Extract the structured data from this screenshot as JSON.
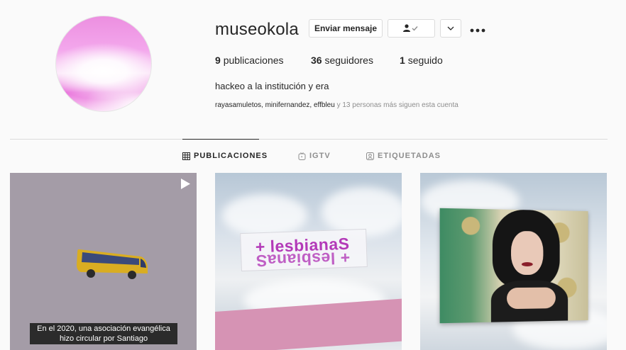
{
  "profile": {
    "username": "museokola",
    "buttons": {
      "message": "Enviar mensaje"
    },
    "stats": {
      "posts_count": "9",
      "posts_label": "publicaciones",
      "followers_count": "36",
      "followers_label": "seguidores",
      "following_count": "1",
      "following_label": "seguido"
    },
    "bio": "hackeo a la institución y era",
    "followed_by": {
      "names": "rayasamuletos, minifernandez, effbleu",
      "rest": " y 13 personas más siguen esta cuenta"
    }
  },
  "tabs": [
    {
      "label": "PUBLICACIONES",
      "icon": "grid-icon",
      "active": true
    },
    {
      "label": "IGTV",
      "icon": "igtv-icon",
      "active": false
    },
    {
      "label": "ETIQUETADAS",
      "icon": "tagged-icon",
      "active": false
    }
  ],
  "posts": [
    {
      "type": "video",
      "caption_line1": "En el 2020, una asociación evangélica",
      "caption_line2": "hizo circular por Santiago"
    },
    {
      "type": "image",
      "banner_text": "+ lesbianaS"
    },
    {
      "type": "image"
    }
  ],
  "colors": {
    "text": "#262626",
    "secondary": "#8e8e8e",
    "border": "#dbdbdb",
    "background": "#fafafa",
    "banner_text": "#b33ab8"
  }
}
